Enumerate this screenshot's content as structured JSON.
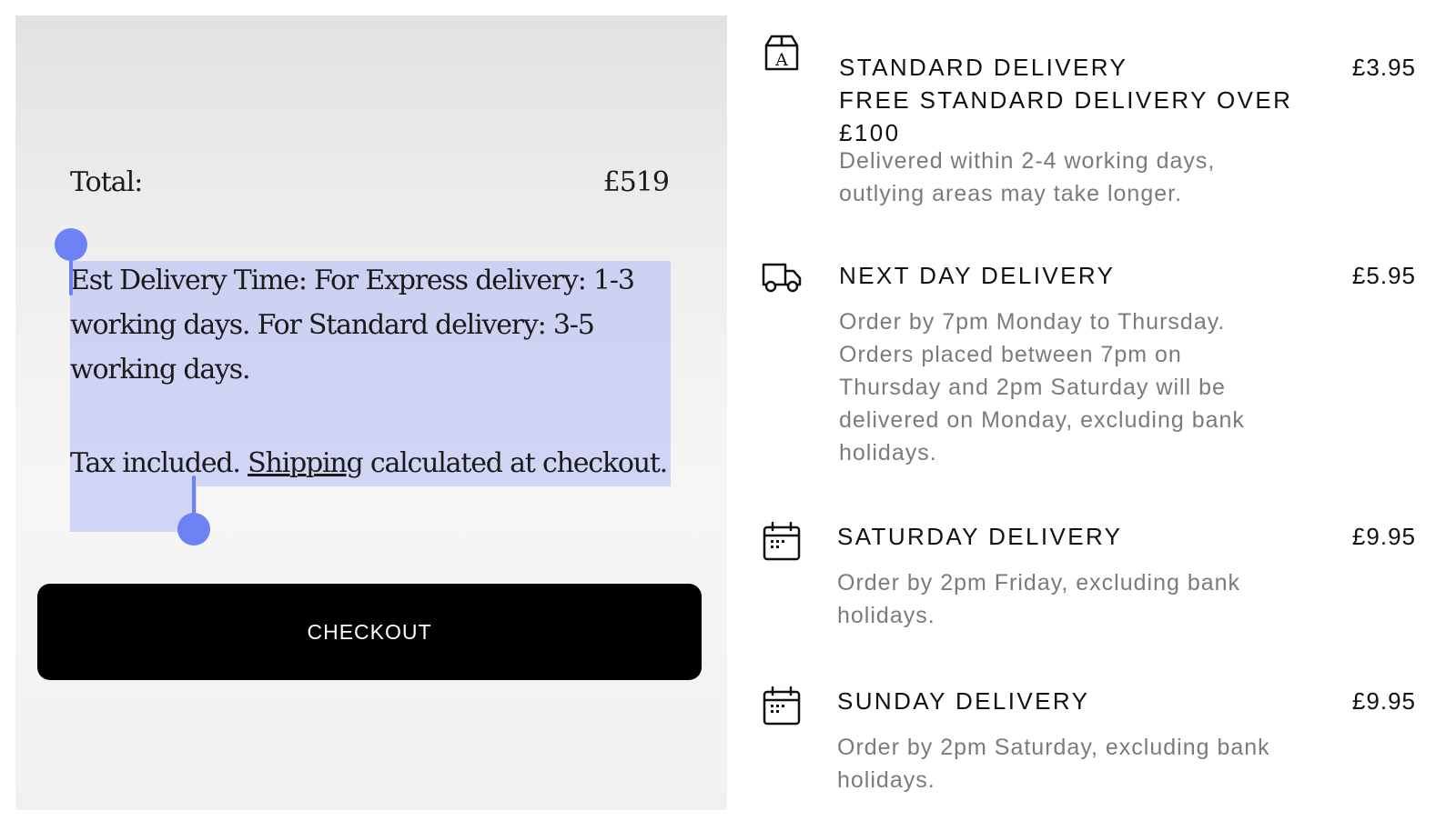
{
  "cart": {
    "total_label": "Total:",
    "total_value": "£519",
    "delivery_time_text": "Est Delivery Time: For Express delivery: 1-3 working days. For Standard delivery: 3-5 working days.",
    "tax_prefix": "Tax included.",
    "shipping_link": "Shipping",
    "tax_suffix": "calculated at checkout.",
    "checkout_label": "CHECKOUT"
  },
  "colors": {
    "selection_highlight": "#848ef5",
    "selection_handle": "#6c82f5",
    "checkout_bg": "#000000"
  },
  "delivery_options": [
    {
      "icon": "package-icon",
      "title_lines": [
        "STANDARD DELIVERY",
        "FREE STANDARD DELIVERY OVER",
        "£100"
      ],
      "price": "£3.95",
      "description_lines": [
        "Delivered within 2-4 working days,",
        "outlying areas may take longer."
      ]
    },
    {
      "icon": "truck-icon",
      "title_lines": [
        "NEXT DAY DELIVERY"
      ],
      "price": "£5.95",
      "description_lines": [
        "Order by 7pm Monday to Thursday.",
        "Orders placed between 7pm on",
        "Thursday and 2pm Saturday will be",
        "delivered on Monday, excluding bank",
        "holidays."
      ]
    },
    {
      "icon": "calendar-icon",
      "title_lines": [
        "SATURDAY DELIVERY"
      ],
      "price": "£9.95",
      "description_lines": [
        "Order by 2pm Friday, excluding bank",
        "holidays."
      ]
    },
    {
      "icon": "calendar-icon",
      "title_lines": [
        "SUNDAY DELIVERY"
      ],
      "price": "£9.95",
      "description_lines": [
        "Order by 2pm Saturday, excluding bank",
        "holidays."
      ]
    }
  ]
}
